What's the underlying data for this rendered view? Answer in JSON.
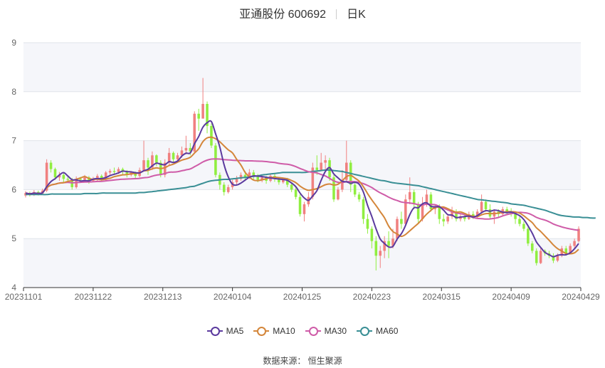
{
  "header": {
    "stock_name": "亚通股份 600692",
    "period": "日K"
  },
  "source": "数据来源： 恒生聚源",
  "colors": {
    "up": "#f08080",
    "down": "#90ee40",
    "grid": "#e0e3ea",
    "band": "#f5f6fa"
  },
  "chart_data": {
    "type": "candlestick",
    "title": "亚通股份 600692",
    "subtitle": "日K",
    "ylim": [
      4,
      9
    ],
    "yticks": [
      4,
      5,
      6,
      7,
      8,
      9
    ],
    "xticks": [
      "20231101",
      "20231122",
      "20231213",
      "20240104",
      "20240125",
      "20240223",
      "20240315",
      "20240409",
      "20240429"
    ],
    "legend": [
      {
        "name": "MA5",
        "color": "#5b3a9e"
      },
      {
        "name": "MA10",
        "color": "#d4863a"
      },
      {
        "name": "MA30",
        "color": "#cf5ca8"
      },
      {
        "name": "MA60",
        "color": "#3a8f95"
      }
    ],
    "candles": [
      [
        5.88,
        5.93,
        5.84,
        5.97
      ],
      [
        5.93,
        5.9,
        5.86,
        5.96
      ],
      [
        5.9,
        5.95,
        5.87,
        5.99
      ],
      [
        5.95,
        5.92,
        5.88,
        5.98
      ],
      [
        5.92,
        5.98,
        5.9,
        6.02
      ],
      [
        5.98,
        6.55,
        5.95,
        6.62
      ],
      [
        6.55,
        6.42,
        6.35,
        6.6
      ],
      [
        6.42,
        6.25,
        6.2,
        6.45
      ],
      [
        6.25,
        6.3,
        6.18,
        6.36
      ],
      [
        6.3,
        6.22,
        6.15,
        6.34
      ],
      [
        6.22,
        6.2,
        6.16,
        6.28
      ],
      [
        6.2,
        6.05,
        6.0,
        6.24
      ],
      [
        6.05,
        6.22,
        6.02,
        6.27
      ],
      [
        6.22,
        6.2,
        6.14,
        6.26
      ],
      [
        6.2,
        6.25,
        6.15,
        6.3
      ],
      [
        6.25,
        6.18,
        6.12,
        6.28
      ],
      [
        6.18,
        6.22,
        6.15,
        6.26
      ],
      [
        6.22,
        6.28,
        6.18,
        6.32
      ],
      [
        6.28,
        6.2,
        6.16,
        6.31
      ],
      [
        6.2,
        6.35,
        6.18,
        6.38
      ],
      [
        6.35,
        6.38,
        6.3,
        6.42
      ],
      [
        6.38,
        6.36,
        6.3,
        6.45
      ],
      [
        6.36,
        6.42,
        6.32,
        6.46
      ],
      [
        6.42,
        6.38,
        6.3,
        6.45
      ],
      [
        6.38,
        6.3,
        6.25,
        6.4
      ],
      [
        6.3,
        6.35,
        6.27,
        6.38
      ],
      [
        6.35,
        6.28,
        6.22,
        6.37
      ],
      [
        6.28,
        6.4,
        6.25,
        6.45
      ],
      [
        6.4,
        6.6,
        6.38,
        7.0
      ],
      [
        6.6,
        6.45,
        6.3,
        6.65
      ],
      [
        6.45,
        6.7,
        6.4,
        6.78
      ],
      [
        6.7,
        6.55,
        6.48,
        6.72
      ],
      [
        6.55,
        6.3,
        6.25,
        6.6
      ],
      [
        6.3,
        6.55,
        6.25,
        6.62
      ],
      [
        6.55,
        6.75,
        6.5,
        6.85
      ],
      [
        6.75,
        6.62,
        6.55,
        6.78
      ],
      [
        6.62,
        6.7,
        6.58,
        6.75
      ],
      [
        6.7,
        6.8,
        6.65,
        6.88
      ],
      [
        6.8,
        6.85,
        6.72,
        7.1
      ],
      [
        6.85,
        6.78,
        6.7,
        6.95
      ],
      [
        6.78,
        7.55,
        6.75,
        7.6
      ],
      [
        7.55,
        7.45,
        7.2,
        7.65
      ],
      [
        7.45,
        7.75,
        7.5,
        8.28
      ],
      [
        7.75,
        7.3,
        7.15,
        7.8
      ],
      [
        7.3,
        6.9,
        6.85,
        7.35
      ],
      [
        6.9,
        6.3,
        6.25,
        6.95
      ],
      [
        6.3,
        6.1,
        6.0,
        6.35
      ],
      [
        6.1,
        5.95,
        5.88,
        6.15
      ],
      [
        5.95,
        6.05,
        5.92,
        6.1
      ],
      [
        6.05,
        6.15,
        6.0,
        6.2
      ],
      [
        6.15,
        6.22,
        6.1,
        6.28
      ],
      [
        6.22,
        6.3,
        6.18,
        6.35
      ],
      [
        6.3,
        6.25,
        6.2,
        6.38
      ],
      [
        6.25,
        6.35,
        6.22,
        6.42
      ],
      [
        6.35,
        6.28,
        6.2,
        6.4
      ],
      [
        6.28,
        6.2,
        6.15,
        6.32
      ],
      [
        6.2,
        6.25,
        6.15,
        6.3
      ],
      [
        6.25,
        6.18,
        6.12,
        6.28
      ],
      [
        6.18,
        6.28,
        6.15,
        6.32
      ],
      [
        6.28,
        6.22,
        6.16,
        6.32
      ],
      [
        6.22,
        6.15,
        6.1,
        6.25
      ],
      [
        6.15,
        6.2,
        6.12,
        6.25
      ],
      [
        6.2,
        6.1,
        6.05,
        6.24
      ],
      [
        6.1,
        6.0,
        5.95,
        6.15
      ],
      [
        6.0,
        5.85,
        5.8,
        6.05
      ],
      [
        5.85,
        5.5,
        5.45,
        5.9
      ],
      [
        5.5,
        5.7,
        5.35,
        5.75
      ],
      [
        5.7,
        5.85,
        5.65,
        5.95
      ],
      [
        5.85,
        6.45,
        5.8,
        6.55
      ],
      [
        6.45,
        6.4,
        6.3,
        6.7
      ],
      [
        6.4,
        6.55,
        6.38,
        6.75
      ],
      [
        6.55,
        6.6,
        6.4,
        6.7
      ],
      [
        6.6,
        6.25,
        6.18,
        6.65
      ],
      [
        6.25,
        5.8,
        5.75,
        6.3
      ],
      [
        5.8,
        6.0,
        5.78,
        6.05
      ],
      [
        6.0,
        6.2,
        5.95,
        6.4
      ],
      [
        6.2,
        6.55,
        6.15,
        7.0
      ],
      [
        6.55,
        6.1,
        5.95,
        6.6
      ],
      [
        6.1,
        5.9,
        5.85,
        6.15
      ],
      [
        5.9,
        5.8,
        5.75,
        5.95
      ],
      [
        5.8,
        5.4,
        5.3,
        5.85
      ],
      [
        5.4,
        5.2,
        5.1,
        5.5
      ],
      [
        5.2,
        4.95,
        4.8,
        5.25
      ],
      [
        4.95,
        4.65,
        4.35,
        5.05
      ],
      [
        4.65,
        4.75,
        4.4,
        4.85
      ],
      [
        4.75,
        4.95,
        4.6,
        5.05
      ],
      [
        4.95,
        4.85,
        4.6,
        5.15
      ],
      [
        4.85,
        5.0,
        4.8,
        5.2
      ],
      [
        5.0,
        5.4,
        4.95,
        5.45
      ],
      [
        5.4,
        5.3,
        5.2,
        5.55
      ],
      [
        5.3,
        5.8,
        5.25,
        5.9
      ],
      [
        5.8,
        5.95,
        5.7,
        6.25
      ],
      [
        5.95,
        5.7,
        5.6,
        6.0
      ],
      [
        5.7,
        5.4,
        5.3,
        5.75
      ],
      [
        5.4,
        5.7,
        5.35,
        5.85
      ],
      [
        5.7,
        5.9,
        5.65,
        6.0
      ],
      [
        5.9,
        5.6,
        5.55,
        5.95
      ],
      [
        5.6,
        5.65,
        5.5,
        5.7
      ],
      [
        5.65,
        5.4,
        5.3,
        5.7
      ],
      [
        5.4,
        5.35,
        5.25,
        5.5
      ],
      [
        5.35,
        5.45,
        5.3,
        5.5
      ],
      [
        5.45,
        5.55,
        5.4,
        5.65
      ],
      [
        5.55,
        5.4,
        5.35,
        5.6
      ],
      [
        5.4,
        5.45,
        5.35,
        5.5
      ],
      [
        5.45,
        5.4,
        5.35,
        5.5
      ],
      [
        5.4,
        5.5,
        5.38,
        5.55
      ],
      [
        5.5,
        5.45,
        5.4,
        5.56
      ],
      [
        5.45,
        5.55,
        5.42,
        5.6
      ],
      [
        5.55,
        5.75,
        5.5,
        5.9
      ],
      [
        5.75,
        5.6,
        5.55,
        5.8
      ],
      [
        5.6,
        5.45,
        5.4,
        5.7
      ],
      [
        5.45,
        5.55,
        5.3,
        5.6
      ],
      [
        5.55,
        5.5,
        5.42,
        5.6
      ],
      [
        5.5,
        5.6,
        5.45,
        5.65
      ],
      [
        5.6,
        5.55,
        5.48,
        5.65
      ],
      [
        5.55,
        5.5,
        5.45,
        5.62
      ],
      [
        5.5,
        5.4,
        5.3,
        5.55
      ],
      [
        5.4,
        5.3,
        5.25,
        5.45
      ],
      [
        5.3,
        5.2,
        5.15,
        5.35
      ],
      [
        5.2,
        4.9,
        4.85,
        5.25
      ],
      [
        4.9,
        4.75,
        4.7,
        4.95
      ],
      [
        4.75,
        4.5,
        4.45,
        4.8
      ],
      [
        4.5,
        4.75,
        4.48,
        4.8
      ],
      [
        4.75,
        4.7,
        4.65,
        4.78
      ],
      [
        4.7,
        4.65,
        4.6,
        4.75
      ],
      [
        4.65,
        4.55,
        4.5,
        4.7
      ],
      [
        4.55,
        4.65,
        4.52,
        4.7
      ],
      [
        4.65,
        4.8,
        4.62,
        4.85
      ],
      [
        4.8,
        4.7,
        4.65,
        4.85
      ],
      [
        4.7,
        4.85,
        4.68,
        4.9
      ],
      [
        4.85,
        4.95,
        4.8,
        5.0
      ],
      [
        4.95,
        5.2,
        4.92,
        5.25
      ]
    ],
    "ma60": [
      5.9,
      5.9,
      5.9,
      5.9,
      5.9,
      5.9,
      5.91,
      5.91,
      5.91,
      5.91,
      5.91,
      5.91,
      5.91,
      5.91,
      5.92,
      5.92,
      5.92,
      5.92,
      5.93,
      5.93,
      5.93,
      5.93,
      5.93,
      5.93,
      5.93,
      5.93,
      5.93,
      5.94,
      5.94,
      5.95,
      5.96,
      5.97,
      5.98,
      5.99,
      6.0,
      6.01,
      6.02,
      6.03,
      6.04,
      6.06,
      6.07,
      6.1,
      6.13,
      6.16,
      6.18,
      6.19,
      6.2,
      6.21,
      6.21,
      6.22,
      6.23,
      6.24,
      6.25,
      6.26,
      6.27,
      6.28,
      6.3,
      6.31,
      6.32,
      6.33,
      6.34,
      6.35,
      6.35,
      6.35,
      6.35,
      6.35,
      6.35,
      6.36,
      6.37,
      6.38,
      6.39,
      6.4,
      6.4,
      6.39,
      6.38,
      6.37,
      6.35,
      6.33,
      6.31,
      6.29,
      6.27,
      6.25,
      6.23,
      6.21,
      6.19,
      6.18,
      6.16,
      6.14,
      6.13,
      6.12,
      6.11,
      6.1,
      6.09,
      6.08,
      6.06,
      6.04,
      6.02,
      6.0,
      5.98,
      5.96,
      5.94,
      5.92,
      5.9,
      5.88,
      5.86,
      5.84,
      5.82,
      5.8,
      5.79,
      5.78,
      5.77,
      5.76,
      5.75,
      5.74,
      5.73,
      5.71,
      5.7,
      5.69,
      5.68,
      5.66,
      5.64,
      5.62,
      5.6,
      5.58,
      5.55,
      5.52,
      5.49,
      5.47,
      5.46,
      5.45,
      5.44,
      5.44,
      5.43,
      5.43,
      5.42,
      5.42
    ]
  }
}
